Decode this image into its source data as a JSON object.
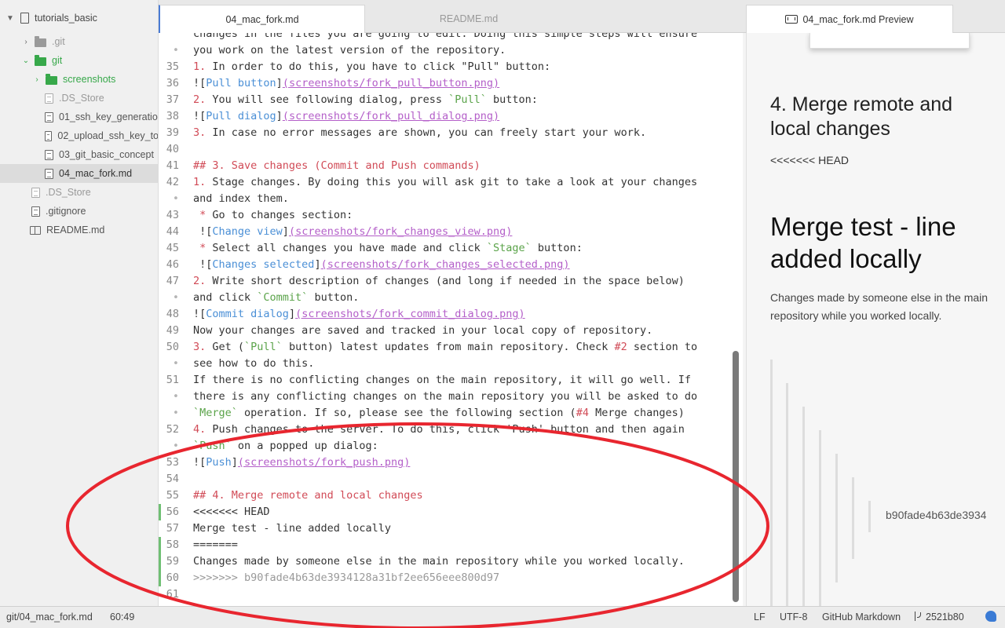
{
  "sidebar": {
    "project": "tutorials_basic",
    "items": [
      {
        "label": ".git",
        "kind": "folder"
      },
      {
        "label": "git",
        "kind": "folder"
      },
      {
        "label": "screenshots",
        "kind": "folder"
      },
      {
        "label": ".DS_Store",
        "kind": "file"
      },
      {
        "label": "01_ssh_key_generatio",
        "kind": "file"
      },
      {
        "label": "02_upload_ssh_key_to",
        "kind": "file"
      },
      {
        "label": "03_git_basic_concept",
        "kind": "file"
      },
      {
        "label": "04_mac_fork.md",
        "kind": "file"
      },
      {
        "label": ".DS_Store",
        "kind": "file"
      },
      {
        "label": ".gitignore",
        "kind": "file"
      },
      {
        "label": "README.md",
        "kind": "book"
      }
    ]
  },
  "tabs": [
    {
      "label": "04_mac_fork.md"
    },
    {
      "label": "README.md"
    }
  ],
  "preview_tab": {
    "label": "04_mac_fork.md Preview"
  },
  "editor": {
    "lines": [
      {
        "n": "",
        "segs": [
          {
            "t": "changes in the files you are going to edit. Doing this simple steps will ensure",
            "c": ""
          }
        ]
      },
      {
        "n": "•",
        "segs": [
          {
            "t": "you work on the latest version of the repository.",
            "c": ""
          }
        ]
      },
      {
        "n": "35",
        "segs": [
          {
            "t": "1. ",
            "c": "red"
          },
          {
            "t": "In order to do this, you have to click \"Pull\" button:",
            "c": ""
          }
        ]
      },
      {
        "n": "36",
        "segs": [
          {
            "t": "![",
            "c": ""
          },
          {
            "t": "Pull button",
            "c": "blue"
          },
          {
            "t": "]",
            "c": ""
          },
          {
            "t": "(screenshots/fork_pull_button.png)",
            "c": "purple"
          }
        ]
      },
      {
        "n": "37",
        "segs": [
          {
            "t": "2. ",
            "c": "red"
          },
          {
            "t": "You will see following dialog, press ",
            "c": ""
          },
          {
            "t": "`Pull`",
            "c": "green"
          },
          {
            "t": " button:",
            "c": ""
          }
        ]
      },
      {
        "n": "38",
        "segs": [
          {
            "t": "![",
            "c": ""
          },
          {
            "t": "Pull dialog",
            "c": "blue"
          },
          {
            "t": "]",
            "c": ""
          },
          {
            "t": "(screenshots/fork_pull_dialog.png)",
            "c": "purple"
          }
        ]
      },
      {
        "n": "39",
        "segs": [
          {
            "t": "3. ",
            "c": "red"
          },
          {
            "t": "In case no error messages are shown, you can freely start your work.",
            "c": ""
          }
        ]
      },
      {
        "n": "40",
        "segs": []
      },
      {
        "n": "41",
        "segs": [
          {
            "t": "## 3. Save changes (Commit and Push commands)",
            "c": "hl"
          }
        ]
      },
      {
        "n": "42",
        "segs": [
          {
            "t": "1. ",
            "c": "red"
          },
          {
            "t": "Stage changes. By doing this you will ask git to take a look at your changes",
            "c": ""
          }
        ]
      },
      {
        "n": "•",
        "segs": [
          {
            "t": "and index them.",
            "c": ""
          }
        ]
      },
      {
        "n": "43",
        "segs": [
          {
            "t": " * ",
            "c": "red"
          },
          {
            "t": "Go to changes section:",
            "c": ""
          }
        ]
      },
      {
        "n": "44",
        "segs": [
          {
            "t": " ![",
            "c": ""
          },
          {
            "t": "Change view",
            "c": "blue"
          },
          {
            "t": "]",
            "c": ""
          },
          {
            "t": "(screenshots/fork_changes_view.png)",
            "c": "purple"
          }
        ]
      },
      {
        "n": "45",
        "segs": [
          {
            "t": " * ",
            "c": "red"
          },
          {
            "t": "Select all changes you have made and click ",
            "c": ""
          },
          {
            "t": "`Stage`",
            "c": "green"
          },
          {
            "t": " button:",
            "c": ""
          }
        ]
      },
      {
        "n": "46",
        "segs": [
          {
            "t": " ![",
            "c": ""
          },
          {
            "t": "Changes selected",
            "c": "blue"
          },
          {
            "t": "]",
            "c": ""
          },
          {
            "t": "(screenshots/fork_changes_selected.png)",
            "c": "purple"
          }
        ]
      },
      {
        "n": "47",
        "segs": [
          {
            "t": "2. ",
            "c": "red"
          },
          {
            "t": "Write short description of changes (and long if needed in the space below)",
            "c": ""
          }
        ]
      },
      {
        "n": "•",
        "segs": [
          {
            "t": "and click ",
            "c": ""
          },
          {
            "t": "`Commit`",
            "c": "green"
          },
          {
            "t": " button.",
            "c": ""
          }
        ]
      },
      {
        "n": "48",
        "segs": [
          {
            "t": "![",
            "c": ""
          },
          {
            "t": "Commit dialog",
            "c": "blue"
          },
          {
            "t": "]",
            "c": ""
          },
          {
            "t": "(screenshots/fork_commit_dialog.png)",
            "c": "purple"
          }
        ]
      },
      {
        "n": "49",
        "segs": [
          {
            "t": "Now your changes are saved and tracked in your local copy of repository.",
            "c": ""
          }
        ]
      },
      {
        "n": "50",
        "segs": [
          {
            "t": "3. ",
            "c": "red"
          },
          {
            "t": "Get (",
            "c": ""
          },
          {
            "t": "`Pull`",
            "c": "green"
          },
          {
            "t": " button) latest updates from main repository. Check ",
            "c": ""
          },
          {
            "t": "#2",
            "c": "red"
          },
          {
            "t": " section to",
            "c": ""
          }
        ]
      },
      {
        "n": "•",
        "segs": [
          {
            "t": "see how to do this.",
            "c": ""
          }
        ]
      },
      {
        "n": "51",
        "segs": [
          {
            "t": "If there is no conflicting changes on the main repository, it will go well. If",
            "c": ""
          }
        ]
      },
      {
        "n": "•",
        "segs": [
          {
            "t": "there is any conflicting changes on the main repository you will be asked to do",
            "c": ""
          }
        ]
      },
      {
        "n": "•",
        "segs": [
          {
            "t": "`Merge`",
            "c": "green"
          },
          {
            "t": " operation. If so, please see the following section (",
            "c": ""
          },
          {
            "t": "#4",
            "c": "red"
          },
          {
            "t": " Merge changes)",
            "c": ""
          }
        ]
      },
      {
        "n": "52",
        "segs": [
          {
            "t": "4. ",
            "c": "red"
          },
          {
            "t": "Push changes to the server. To do this, click 'Push' button and then again",
            "c": ""
          }
        ]
      },
      {
        "n": "•",
        "segs": [
          {
            "t": "`Push`",
            "c": "green"
          },
          {
            "t": " on a popped up dialog:",
            "c": ""
          }
        ]
      },
      {
        "n": "53",
        "segs": [
          {
            "t": "![",
            "c": ""
          },
          {
            "t": "Push",
            "c": "blue"
          },
          {
            "t": "]",
            "c": ""
          },
          {
            "t": "(screenshots/fork_push.png)",
            "c": "purple"
          }
        ]
      },
      {
        "n": "54",
        "segs": []
      },
      {
        "n": "55",
        "segs": [
          {
            "t": "## 4. Merge remote and local changes",
            "c": "hl"
          }
        ]
      },
      {
        "n": "56",
        "segs": [
          {
            "t": "<<<<<<< HEAD",
            "c": ""
          }
        ],
        "mark": true
      },
      {
        "n": "57",
        "segs": [
          {
            "t": "Merge test - line added locally",
            "c": ""
          }
        ]
      },
      {
        "n": "58",
        "segs": [
          {
            "t": "=======",
            "c": ""
          }
        ],
        "mark": true
      },
      {
        "n": "59",
        "segs": [
          {
            "t": "Changes made by someone else in the main repository while you worked locally.",
            "c": ""
          }
        ],
        "mark": true
      },
      {
        "n": "60",
        "segs": [
          {
            "t": ">>>>>>> b90fade4b63de3934128a31bf2ee656eee800d97",
            "c": "gray"
          }
        ],
        "mark": true
      },
      {
        "n": "61",
        "segs": []
      }
    ]
  },
  "preview": {
    "h2": "4. Merge remote and local changes",
    "p1": "<<<<<<< HEAD",
    "h1": "Merge test - line added locally",
    "p2": "Changes made by someone else in the main repository while you worked locally.",
    "hash": "b90fade4b63de3934"
  },
  "status": {
    "path": "git/04_mac_fork.md",
    "cursor": "60:49",
    "eol": "LF",
    "encoding": "UTF-8",
    "grammar": "GitHub Markdown",
    "branch": "2521b80"
  },
  "colors": {
    "annotation": "#e8262f",
    "accent": "#4a7bd4",
    "git_green": "#37a84a"
  },
  "icons": {
    "folder": "folder-icon",
    "file": "file-icon",
    "readme": "book-icon",
    "branch": "branch-icon"
  }
}
